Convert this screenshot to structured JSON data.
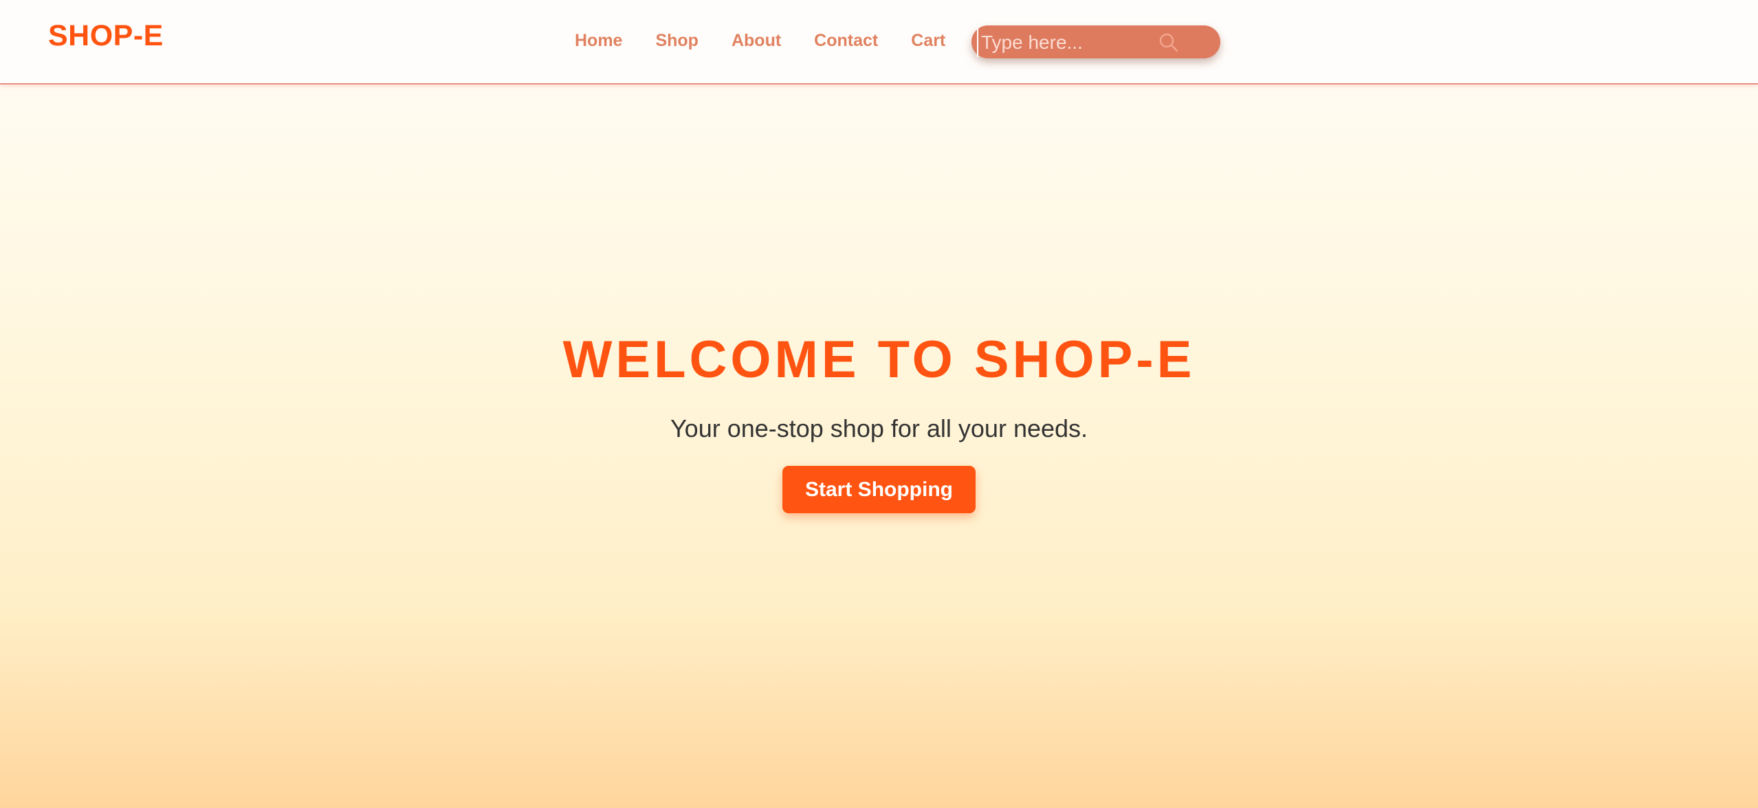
{
  "brand": {
    "logo_text": "SHOP-E"
  },
  "nav": {
    "links": [
      {
        "label": "Home"
      },
      {
        "label": "Shop"
      },
      {
        "label": "About"
      },
      {
        "label": "Contact"
      },
      {
        "label": "Cart"
      }
    ]
  },
  "search": {
    "placeholder": "Type here...",
    "value": "",
    "icon": "search-icon"
  },
  "hero": {
    "title": "WELCOME TO SHOP-E",
    "subtitle": "Your one-stop shop for all your needs.",
    "cta_label": "Start Shopping"
  },
  "colors": {
    "accent": "#ff5410",
    "nav_link": "#e08260",
    "search_bg": "#de7a5e",
    "subtitle_text": "#333333"
  }
}
